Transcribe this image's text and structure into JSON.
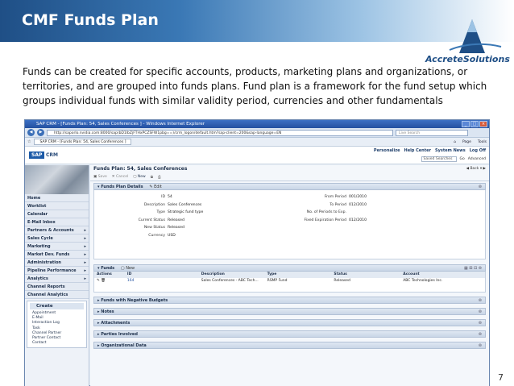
{
  "slide": {
    "title": "CMF Funds Plan",
    "logo_text": "AccreteSolutions",
    "body": "Funds can be created for specific accounts, products, marketing plans and organizations, or territories, and are grouped into funds plans. Fund plan is a framework for the fund setup which groups individual funds with similar validity period, currencies and other fundamentals",
    "page_number": "7"
  },
  "browser": {
    "title": "SAP CRM - [Funds Plan: 54, Sales Conferences ] - Windows Internet Explorer",
    "url": "http://saporlo.nvidia.com:8000/sap(bD1lbZjFTHxPCZSFW1pbg==)/crm_logon/default.htm?sap-client=200&sap-language=EN",
    "search_placeholder": "Live Search",
    "tab_label": "SAP CRM - [Funds Plan: 54, Sales Conferences ]",
    "tools": [
      "Page",
      "Tools"
    ]
  },
  "sap": {
    "logo": "SAP",
    "product": "CRM",
    "header_links": [
      "Personalize",
      "Help Center",
      "System News",
      "Log Off"
    ],
    "saved_searches_label": "Saved Searches",
    "go_label": "Go",
    "advanced_label": "Advanced"
  },
  "sidebar": {
    "items": [
      {
        "label": "Home",
        "arrow": ""
      },
      {
        "label": "Worklist",
        "arrow": ""
      },
      {
        "label": "Calendar",
        "arrow": ""
      },
      {
        "label": "E-Mail Inbox",
        "arrow": ""
      },
      {
        "label": "Partners & Accounts",
        "arrow": "▸"
      },
      {
        "label": "Sales Cycle",
        "arrow": "▸"
      },
      {
        "label": "Marketing",
        "arrow": "▸"
      },
      {
        "label": "Market Dev. Funds",
        "arrow": "▸"
      },
      {
        "label": "Administration",
        "arrow": "▸"
      },
      {
        "label": "Pipeline Performance",
        "arrow": "▸"
      },
      {
        "label": "Analytics",
        "arrow": "▸"
      },
      {
        "label": "Channel Reports",
        "arrow": ""
      },
      {
        "label": "Channel Analytics",
        "arrow": ""
      }
    ],
    "create_label": "Create",
    "create_links": [
      "Appointment",
      "E-Mail",
      "Interaction Log",
      "Task",
      "Channel Partner",
      "Partner Contact",
      "Contact"
    ]
  },
  "main": {
    "page_title": "Funds Plan: 54, Sales Conferences",
    "back_label": "Back",
    "toolbar": {
      "save": "Save",
      "cancel": "Cancel",
      "new": "New"
    },
    "details_section": "Funds Plan Details",
    "edit_label": "Edit",
    "left_fields": [
      {
        "label": "ID",
        "value": "54"
      },
      {
        "label": "Description",
        "value": "Sales Conferences"
      },
      {
        "label": "Type",
        "value": "Strategic fund type"
      },
      {
        "label": "Current Status",
        "value": "Released"
      },
      {
        "label": "New Status",
        "value": "Released"
      },
      {
        "label": "Currency",
        "value": "USD"
      }
    ],
    "right_fields": [
      {
        "label": "From Period",
        "value": "001/2010"
      },
      {
        "label": "To Period",
        "value": "012/2010"
      },
      {
        "label": "No. of Periods to Exp.",
        "value": ""
      },
      {
        "label": "Fixed Expiration Period",
        "value": "012/2010"
      }
    ],
    "funds_section": "Funds",
    "funds_new": "New",
    "funds_columns": [
      "Actions",
      "ID",
      "Description",
      "Type",
      "Status",
      "Account"
    ],
    "funds_rows": [
      {
        "id": "164",
        "description": "Sales Conferences - ABC Tech...",
        "type": "RSMP Fund",
        "status": "Released",
        "account": "ABC Technologies Inc."
      }
    ],
    "collapsed_sections": [
      "Funds with Negative Budgets",
      "Notes",
      "Attachments",
      "Parties Involved",
      "Organizational Data"
    ]
  }
}
